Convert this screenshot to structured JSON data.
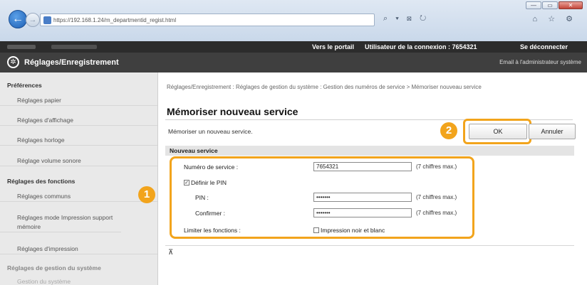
{
  "browser": {
    "url": "https://192.168.1.24/m_departmentid_regist.html",
    "window_buttons": [
      "—",
      "▭",
      "✕"
    ],
    "addr_tools": "⌕ ▾ ⊠ ↻",
    "right_tools": "⌂ ☆ ⚙"
  },
  "topbar": {
    "portal_link": "Vers le portail",
    "user_text": "Utilisateur de la connexion :  7654321",
    "logout": "Se déconnecter"
  },
  "header": {
    "title": "Réglages/Enregistrement",
    "email_admin": "Email à l'administrateur système"
  },
  "sidebar": {
    "preferences_heading": "Préférences",
    "items_pref": [
      "Réglages papier",
      "Réglages d'affichage",
      "Réglages horloge",
      "Réglage volume sonore"
    ],
    "functions_heading": "Réglages des fonctions",
    "items_func": [
      "Réglages communs",
      "Réglages mode Impression support mémoire",
      "Réglages d'impression"
    ],
    "system_heading": "Réglages de gestion du système",
    "system_item": "Gestion du système"
  },
  "main": {
    "breadcrumb": "Réglages/Enregistrement : Réglages de gestion du système : Gestion des numéros de service > Mémoriser nouveau service",
    "title": "Mémoriser nouveau service",
    "description": "Mémoriser un nouveau service.",
    "ok_label": "OK",
    "cancel_label": "Annuler",
    "section_title": "Nouveau service",
    "service_number_label": "Numéro de service :",
    "service_number_value": "7654321",
    "service_hint": "(7 chiffres max.)",
    "define_pin_label": "Définir le PIN",
    "define_pin_checked": "✓",
    "pin_label": "PIN :",
    "pin_value": "•••••••",
    "pin_hint": "(7 chiffres max.)",
    "confirm_label": "Confirmer :",
    "confirm_value": "•••••••",
    "confirm_hint": "(7 chiffres max.)",
    "limit_label": "Limiter les fonctions :",
    "bw_print_label": "Impression noir et blanc",
    "top_marker": "⊼"
  },
  "badges": {
    "one": "1",
    "two": "2"
  },
  "colors": {
    "highlight": "#f2a41c",
    "header_bg": "#3f3f3f",
    "topbar_bg": "#2c2c2c"
  }
}
